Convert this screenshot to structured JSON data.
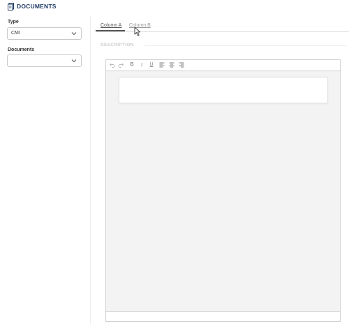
{
  "header": {
    "title": "DOCUMENTS",
    "icon": "documents-icon"
  },
  "sidebar": {
    "type_label": "Type",
    "type_value": "CMI",
    "documents_label": "Documents",
    "documents_value": ""
  },
  "tabs": [
    {
      "label": "Column A",
      "active": true
    },
    {
      "label": "Column B",
      "active": false
    }
  ],
  "description": {
    "label": "DESCRIPTION"
  },
  "toolbar": {
    "undo": "undo-icon",
    "redo": "redo-icon",
    "bold": "B",
    "italic": "I",
    "underline": "U",
    "align_left": "align-left-icon",
    "align_center": "align-center-icon",
    "align_right": "align-right-icon"
  },
  "colors": {
    "brand": "#1f3b63",
    "border": "#d0d0d0",
    "editor_bg": "#f3f3f3"
  }
}
